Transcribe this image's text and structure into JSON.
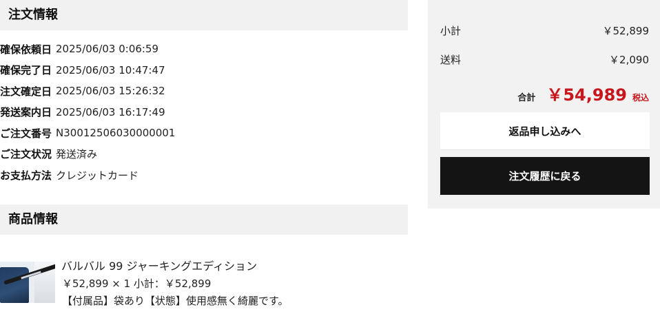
{
  "order_info": {
    "title": "注文情報",
    "rows": [
      {
        "label": "確保依頼日",
        "value": "2025/06/03 0:06:59"
      },
      {
        "label": "確保完了日",
        "value": "2025/06/03 10:47:47"
      },
      {
        "label": "注文確定日",
        "value": "2025/06/03 15:26:32"
      },
      {
        "label": "発送案内日",
        "value": "2025/06/03 16:17:49"
      },
      {
        "label": "ご注文番号",
        "value": "N30012506030000001"
      },
      {
        "label": "ご注文状況",
        "value": "発送済み"
      },
      {
        "label": "お支払方法",
        "value": "クレジットカード"
      }
    ]
  },
  "product_info": {
    "title": "商品情報",
    "items": [
      {
        "name": "バルバル 99 ジャーキングエディション",
        "price_line": "￥52,899 × 1  小計：￥52,899",
        "note": "【付属品】袋あり【状態】使用感無く綺麗です。",
        "thumbnail_icon": "fishing-rod-product-image"
      }
    ]
  },
  "summary": {
    "subtotal_label": "小計",
    "subtotal_value": "￥52,899",
    "shipping_label": "送料",
    "shipping_value": "￥2,090",
    "total_label": "合計",
    "total_value": "￥54,989",
    "tax_label": "税込",
    "return_button": "返品申し込みへ",
    "history_button": "注文履歴に戻る"
  },
  "colors": {
    "accent_total": "#c8161d",
    "panel_bg": "#f2f2f2",
    "header_bg": "#f1f1f1",
    "dark_button": "#141414"
  }
}
